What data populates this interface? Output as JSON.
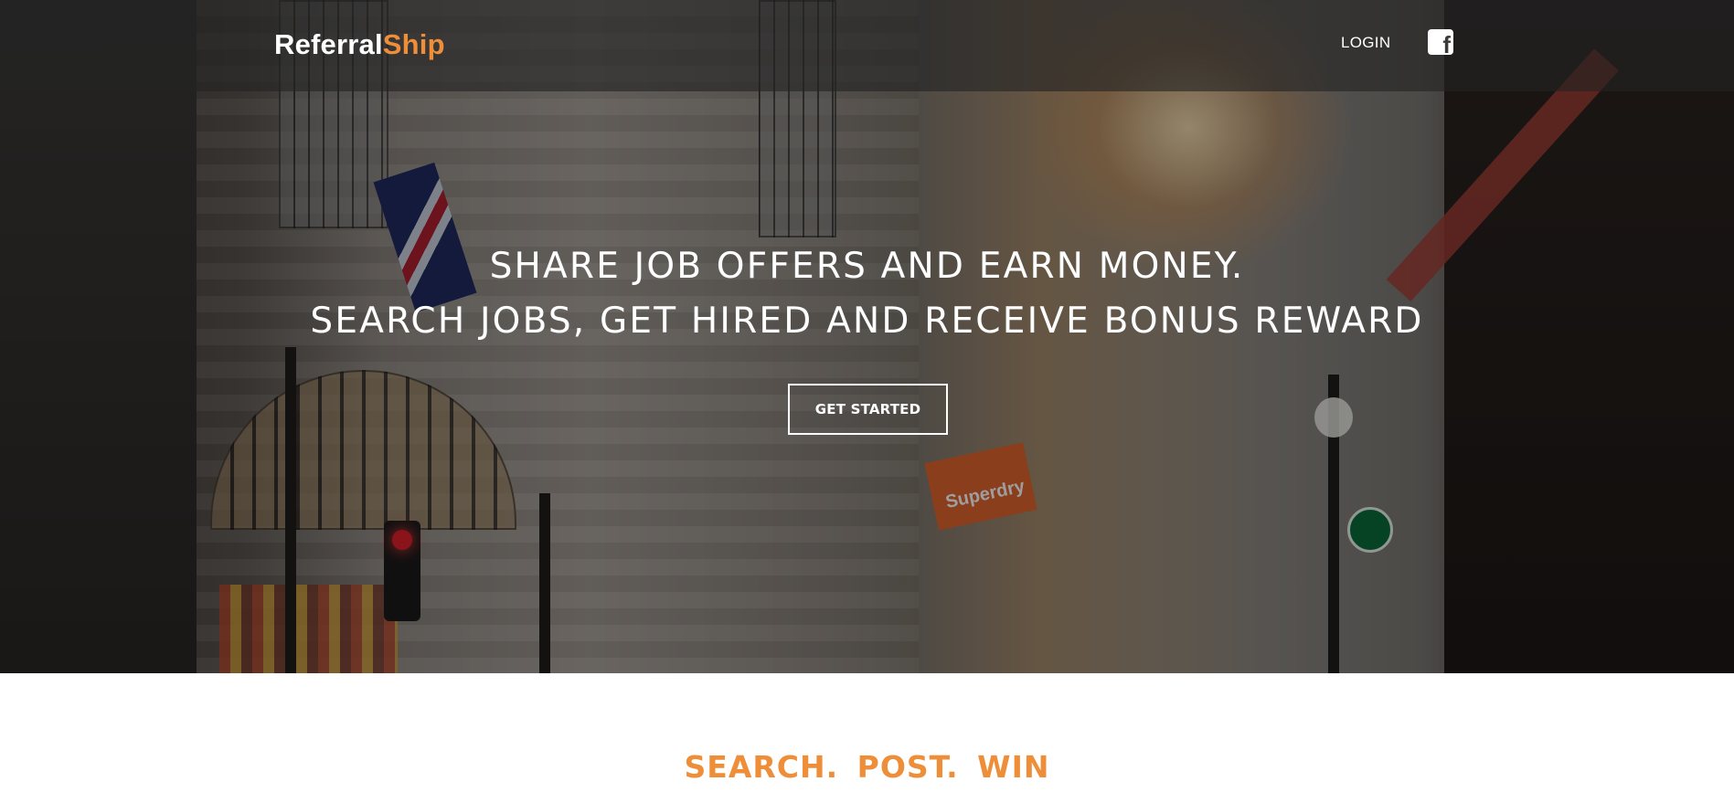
{
  "header": {
    "brand_first": "Referral",
    "brand_second": "Ship",
    "login_label": "LOGIN",
    "facebook_icon": "facebook-icon"
  },
  "hero": {
    "headline_line1": "SHARE JOB OFFERS AND EARN MONEY.",
    "headline_line2": "SEARCH JOBS, GET HIRED AND RECEIVE BONUS REWARD",
    "cta_label": "GET STARTED",
    "background": "city-street-photo"
  },
  "section": {
    "title": "SEARCH.  POST.  WIN"
  },
  "colors": {
    "accent": "#ef8e39",
    "header_bg": "#232323",
    "text_light": "#ffffff"
  }
}
